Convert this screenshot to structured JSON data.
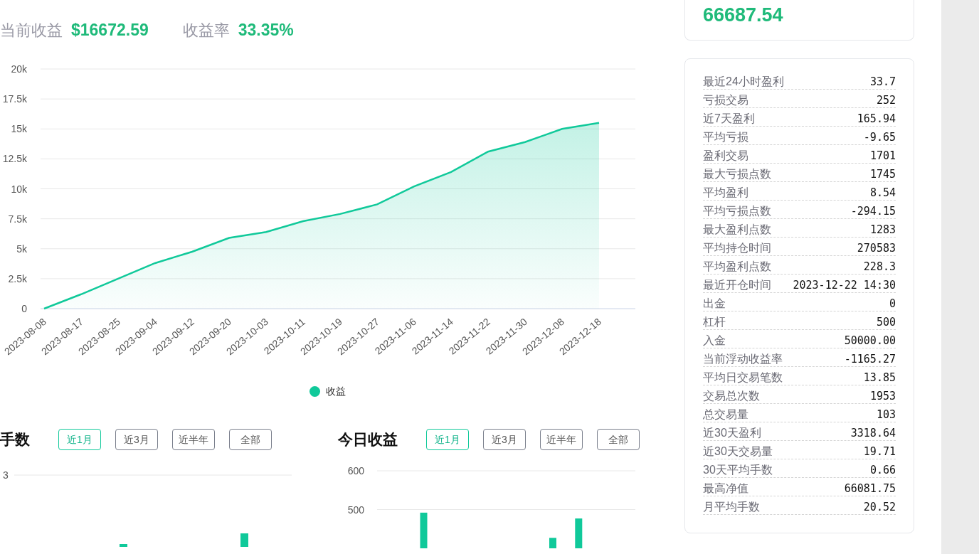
{
  "header": {
    "items": [
      {
        "label": "当前收益",
        "value": "$16672.59"
      },
      {
        "label": "收益率",
        "value": "33.35%"
      }
    ]
  },
  "profit_chart": {
    "chart_data": {
      "type": "area",
      "grid": true,
      "categories": [
        "2023-08-08",
        "2023-08-17",
        "2023-08-25",
        "2023-09-04",
        "2023-09-12",
        "2023-09-20",
        "2023-10-03",
        "2023-10-11",
        "2023-10-19",
        "2023-10-27",
        "2023-11-06",
        "2023-11-14",
        "2023-11-22",
        "2023-11-30",
        "2023-12-08",
        "2023-12-18"
      ],
      "ylim": [
        0,
        20000
      ],
      "yticks": [
        {
          "value": 0,
          "label": "0"
        },
        {
          "value": 2500,
          "label": "2.5k"
        },
        {
          "value": 5000,
          "label": "5k"
        },
        {
          "value": 7500,
          "label": "7.5k"
        },
        {
          "value": 10000,
          "label": "10k"
        },
        {
          "value": 12500,
          "label": "12.5k"
        },
        {
          "value": 15000,
          "label": "15k"
        },
        {
          "value": 17500,
          "label": "17.5k"
        },
        {
          "value": 20000,
          "label": "20k"
        }
      ],
      "series": [
        {
          "name": "收益",
          "color": "#10c99a",
          "values": [
            0,
            1200,
            2500,
            3800,
            4750,
            5900,
            6400,
            7300,
            7900,
            8700,
            10200,
            11400,
            13100,
            13900,
            15000,
            15500
          ]
        }
      ]
    }
  },
  "lots_panel": {
    "title": "手数",
    "filters": [
      {
        "label": "近1月",
        "selected": true
      },
      {
        "label": "近3月",
        "selected": false
      },
      {
        "label": "近半年",
        "selected": false
      },
      {
        "label": "全部",
        "selected": false
      }
    ],
    "ytick": "3"
  },
  "daily_profit_panel": {
    "title": "今日收益",
    "filters": [
      {
        "label": "近1月",
        "selected": true
      },
      {
        "label": "近3月",
        "selected": false
      },
      {
        "label": "近半年",
        "selected": false
      },
      {
        "label": "全部",
        "selected": false
      }
    ],
    "chart_data": {
      "type": "bar",
      "ylim": [
        400,
        600
      ],
      "yticks": [
        500,
        600
      ],
      "series": [
        {
          "color": "#10c99a",
          "values": [
            null,
            null,
            null,
            null,
            null,
            492,
            null,
            null,
            null,
            null,
            null,
            null,
            null,
            null,
            null,
            null,
            null,
            null,
            null,
            null,
            427,
            null,
            null,
            477,
            null,
            null,
            null,
            null,
            null,
            null
          ]
        }
      ]
    }
  },
  "balance_card": {
    "value": "66687.54"
  },
  "stats": [
    {
      "label": "最近24小时盈利",
      "value": "33.7"
    },
    {
      "label": "亏损交易",
      "value": "252"
    },
    {
      "label": "近7天盈利",
      "value": "165.94"
    },
    {
      "label": "平均亏损",
      "value": "-9.65"
    },
    {
      "label": "盈利交易",
      "value": "1701"
    },
    {
      "label": "最大亏损点数",
      "value": "1745"
    },
    {
      "label": "平均盈利",
      "value": "8.54"
    },
    {
      "label": "平均亏损点数",
      "value": "-294.15"
    },
    {
      "label": "最大盈利点数",
      "value": "1283"
    },
    {
      "label": "平均持仓时间",
      "value": "270583"
    },
    {
      "label": "平均盈利点数",
      "value": "228.3"
    },
    {
      "label": "最近开仓时间",
      "value": "2023-12-22 14:30"
    },
    {
      "label": "出金",
      "value": "0"
    },
    {
      "label": "杠杆",
      "value": "500"
    },
    {
      "label": "入金",
      "value": "50000.00"
    },
    {
      "label": "当前浮动收益率",
      "value": "-1165.27"
    },
    {
      "label": "平均日交易笔数",
      "value": "13.85"
    },
    {
      "label": "交易总次数",
      "value": "1953"
    },
    {
      "label": "总交易量",
      "value": "103"
    },
    {
      "label": "近30天盈利",
      "value": "3318.64"
    },
    {
      "label": "近30天交易量",
      "value": "19.71"
    },
    {
      "label": "30天平均手数",
      "value": "0.66"
    },
    {
      "label": "最高净值",
      "value": "66081.75"
    },
    {
      "label": "月平均手数",
      "value": "20.52"
    }
  ]
}
